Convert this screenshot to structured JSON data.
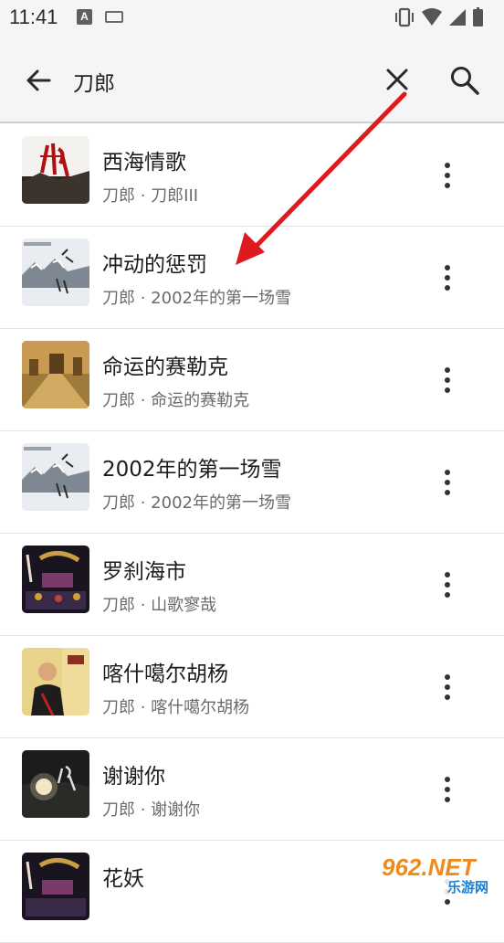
{
  "status_bar": {
    "time": "11:41",
    "notification_icon_letter": "A",
    "icons": [
      "vibrate-icon",
      "wifi-icon",
      "signal-icon",
      "battery-icon"
    ]
  },
  "search": {
    "query": "刀郎"
  },
  "results": [
    {
      "title": "西海情歌",
      "subtitle": "刀郎 · 刀郎III"
    },
    {
      "title": "冲动的惩罚",
      "subtitle": "刀郎 · 2002年的第一场雪"
    },
    {
      "title": "命运的赛勒克",
      "subtitle": "刀郎 · 命运的赛勒克"
    },
    {
      "title": "2002年的第一场雪",
      "subtitle": "刀郎 · 2002年的第一场雪"
    },
    {
      "title": "罗刹海市",
      "subtitle": "刀郎 · 山歌寥哉"
    },
    {
      "title": "喀什噶尔胡杨",
      "subtitle": "刀郎 · 喀什噶尔胡杨"
    },
    {
      "title": "谢谢你",
      "subtitle": "刀郎 · 谢谢你"
    },
    {
      "title": "花妖",
      "subtitle": ""
    }
  ],
  "annotation": {
    "arrow_color": "#e0191f"
  },
  "watermark": {
    "brand": "962.NET",
    "sub": "乐游网"
  }
}
